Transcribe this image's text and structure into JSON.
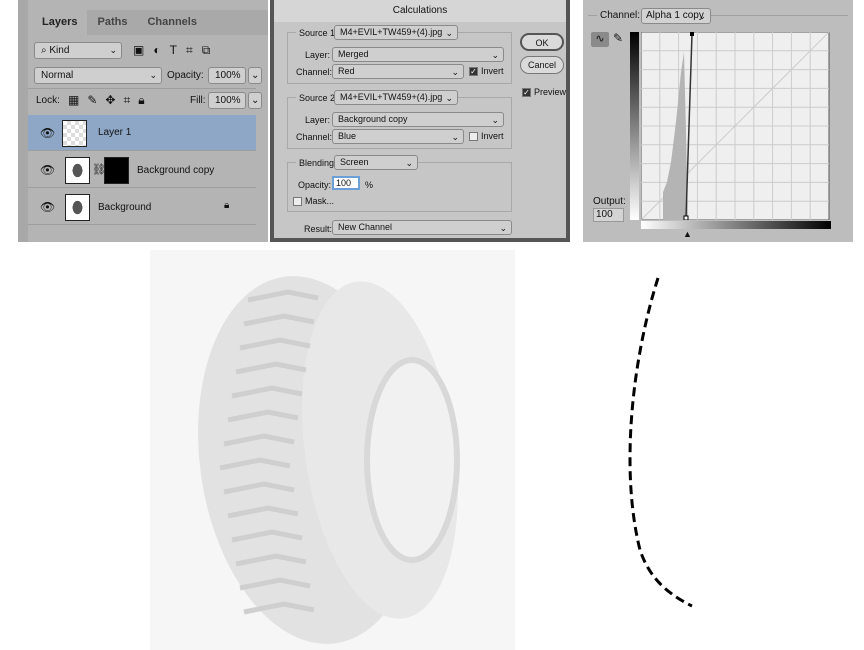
{
  "layers_panel": {
    "tabs": [
      "Layers",
      "Paths",
      "Channels"
    ],
    "filter_kind": "Kind",
    "blend_mode": "Normal",
    "opacity_label": "Opacity:",
    "opacity": "100%",
    "lock_label": "Lock:",
    "fill_label": "Fill:",
    "fill": "100%",
    "layers": [
      {
        "name": "Layer 1",
        "selected": true
      },
      {
        "name": "Background copy",
        "selected": false
      },
      {
        "name": "Background",
        "selected": false,
        "locked": true
      }
    ]
  },
  "calculations": {
    "title": "Calculations",
    "source1": {
      "label": "Source 1:",
      "file": "M4+EVIL+TW459+(4).jpg",
      "layer_label": "Layer:",
      "layer": "Merged",
      "channel_label": "Channel:",
      "channel": "Red",
      "invert_label": "Invert",
      "invert": true
    },
    "source2": {
      "label": "Source 2:",
      "file": "M4+EVIL+TW459+(4).jpg",
      "layer_label": "Layer:",
      "layer": "Background copy",
      "channel_label": "Channel:",
      "channel": "Blue",
      "invert_label": "Invert",
      "invert": false
    },
    "blending_label": "Blending:",
    "blending": "Screen",
    "opacity_label": "Opacity:",
    "opacity": "100",
    "percent": "%",
    "mask_label": "Mask...",
    "mask": false,
    "result_label": "Result:",
    "result": "New Channel",
    "ok": "OK",
    "cancel": "Cancel",
    "preview_label": "Preview",
    "preview": true
  },
  "curves": {
    "channel_label": "Channel:",
    "channel": "Alpha 1 copy",
    "output_label": "Output:",
    "output": "100"
  }
}
